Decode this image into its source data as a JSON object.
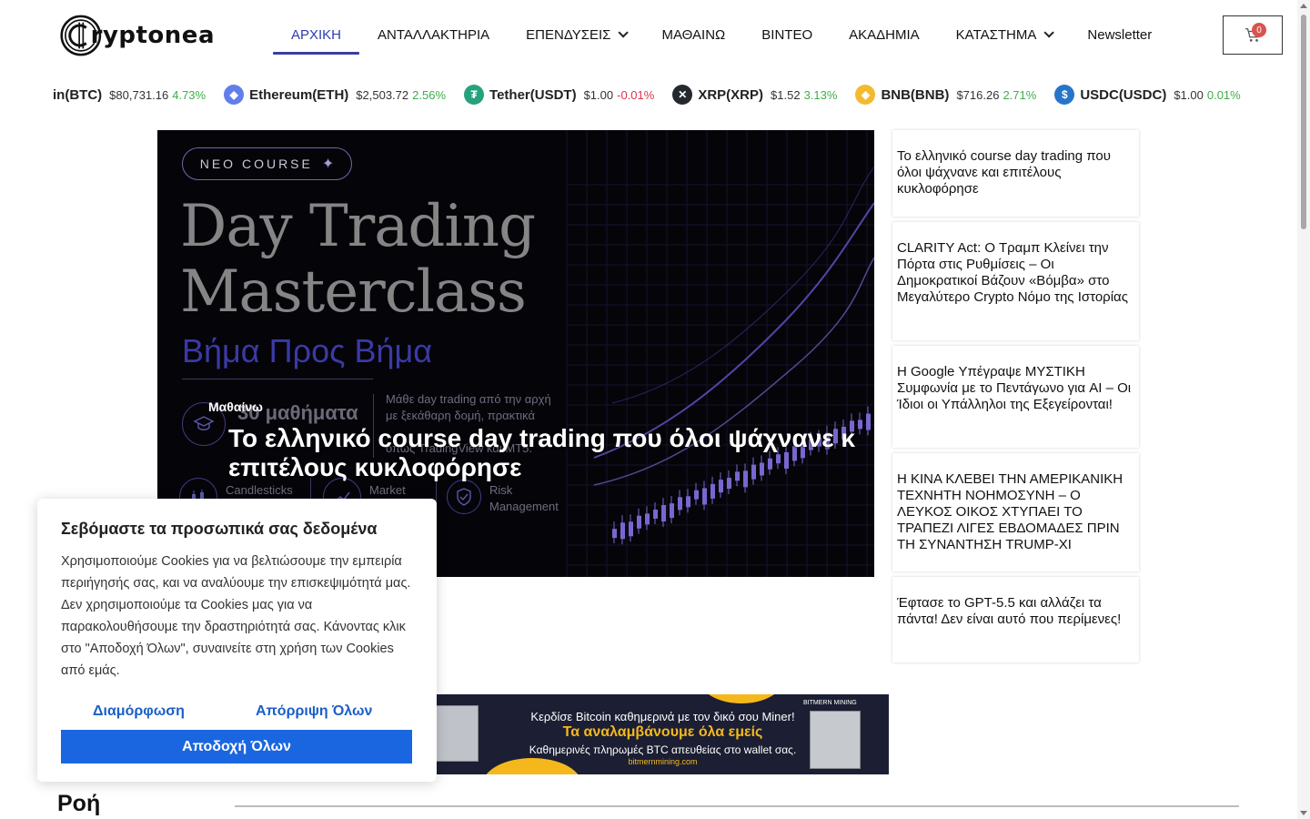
{
  "header": {
    "logo_text": "ryptonea",
    "nav": [
      {
        "label": "ΑΡΧΙΚΗ",
        "active": true,
        "dropdown": false
      },
      {
        "label": "ΑΝΤΑΛΛΑΚΤΗΡΙΑ",
        "active": false,
        "dropdown": false
      },
      {
        "label": "ΕΠΕΝΔΥΣΕΙΣ",
        "active": false,
        "dropdown": true
      },
      {
        "label": "ΜΑΘΑΙΝΩ",
        "active": false,
        "dropdown": false
      },
      {
        "label": "ΒΙΝΤΕΟ",
        "active": false,
        "dropdown": false
      },
      {
        "label": "ΑΚΑΔΗΜΙΑ",
        "active": false,
        "dropdown": false
      },
      {
        "label": "ΚΑΤΑΣΤΗΜΑ",
        "active": false,
        "dropdown": true
      },
      {
        "label": "Newsletter",
        "active": false,
        "dropdown": false
      }
    ],
    "cart_count": "0"
  },
  "ticker": [
    {
      "name": "in(BTC)",
      "price": "$80,731.16",
      "change": "4.73%",
      "dir": "up",
      "icon": "bitcoin-icon",
      "color": "#f7931a",
      "glyph": ""
    },
    {
      "name": "Ethereum(ETH)",
      "price": "$2,503.72",
      "change": "2.56%",
      "dir": "up",
      "icon": "ethereum-icon",
      "color": "#627eea",
      "glyph": "◆"
    },
    {
      "name": "Tether(USDT)",
      "price": "$1.00",
      "change": "-0.01%",
      "dir": "down",
      "icon": "tether-icon",
      "color": "#26a17b",
      "glyph": "₮"
    },
    {
      "name": "XRP(XRP)",
      "price": "$1.52",
      "change": "3.13%",
      "dir": "up",
      "icon": "xrp-icon",
      "color": "#23292f",
      "glyph": "✕"
    },
    {
      "name": "BNB(BNB)",
      "price": "$716.26",
      "change": "2.71%",
      "dir": "up",
      "icon": "bnb-icon",
      "color": "#f3ba2f",
      "glyph": "◈"
    },
    {
      "name": "USDC(USDC)",
      "price": "$1.00",
      "change": "0.01%",
      "dir": "up",
      "icon": "usdc-icon",
      "color": "#2775ca",
      "glyph": "$"
    },
    {
      "name": "",
      "price": "",
      "change": "",
      "dir": "up",
      "icon": "solana-icon",
      "color": "#9945ff",
      "glyph": "≡"
    }
  ],
  "hero": {
    "badge": "NEO COURSE",
    "headline_line1": "Day Trading",
    "headline_line2": "Masterclass",
    "subheadline": "Βήμα Προς Βήμα",
    "lessons": "30 μαθήματα",
    "desc_line1": "Μάθε day trading από την αρχή",
    "desc_line2": "με ξεκάθαρη δομή, πρακτικά",
    "desc_line4": "όπως TradingView και MT5.",
    "feature1": "Candlesticks",
    "feature2": "Market",
    "feature3_line1": "Risk",
    "feature3_line2": "Management",
    "category": "Μαθαίνω",
    "title": "Το ελληνικό course day trading που όλοι ψάχνανε κ επιτέλους κυκλοφόρησε"
  },
  "side_news": [
    "Το ελληνικό course day trading που όλοι ψάχνανε και επιτέλους κυκλοφόρησε",
    "CLARITY Act: Ο Τραμπ Κλείνει την Πόρτα στις Ρυθμίσεις – Οι Δημοκρατικοί Βάζουν «Βόμβα» στο Μεγαλύτερο Crypto Νόμο της Ιστορίας",
    "Η Google Υπέγραψε ΜΥΣΤΙΚΗ Συμφωνία με το Πεντάγωνο για AI – Οι Ίδιοι οι Υπάλληλοι της Εξεγείρονται!",
    "Η ΚΙΝΑ ΚΛΕΒΕΙ ΤΗΝ ΑΜΕΡΙΚΑΝΙΚΗ ΤΕΧΝΗΤΗ ΝΟΗΜΟΣΥΝΗ – Ο ΛΕΥΚΟΣ ΟΙΚΟΣ ΧΤΥΠΑΕΙ ΤΟ ΤΡΑΠΕΖΙ ΛΙΓΕΣ ΕΒΔΟΜΑΔΕΣ ΠΡΙΝ ΤΗ ΣΥΝΑΝΤΗΣΗ TRUMP-XI",
    "Έφτασε το GPT-5.5 και αλλάζει τα πάντα! Δεν είναι αυτό που περίμενες!"
  ],
  "banner": {
    "line1": "Κερδίσε Bitcoin καθημερινά με τον δικό σου Miner!",
    "line2": "Τα αναλαμβάνουμε όλα εμείς",
    "line3": "Καθημερινές πληρωμές BTC απευθείας στο wallet σας.",
    "line4": "bitmernmining.com",
    "brand": "BITMERN MINING"
  },
  "section": {
    "title": "Ροή"
  },
  "cookie": {
    "title": "Σεβόμαστε τα προσωπικά σας δεδομένα",
    "body": "Χρησιμοποιούμε Cookies για να βελτιώσουμε την εμπειρία περιήγησής σας, και να αναλύουμε την επισκεψιμότητά μας. Δεν χρησιμοποιούμε τα Cookies μας για να παρακολουθήσουμε την δραστηριότητά σας. Κάνοντας κλικ στο \"Αποδοχή Όλων\", συναινείτε στη χρήση των Cookies από εμάς.",
    "customize": "Διαμόρφωση",
    "reject": "Απόρριψη Όλων",
    "accept": "Αποδοχή Όλων"
  },
  "colors": {
    "accent": "#2b3bb3",
    "up": "#3dae4a",
    "down": "#e0334a",
    "cookie_button": "#1a66e0"
  }
}
